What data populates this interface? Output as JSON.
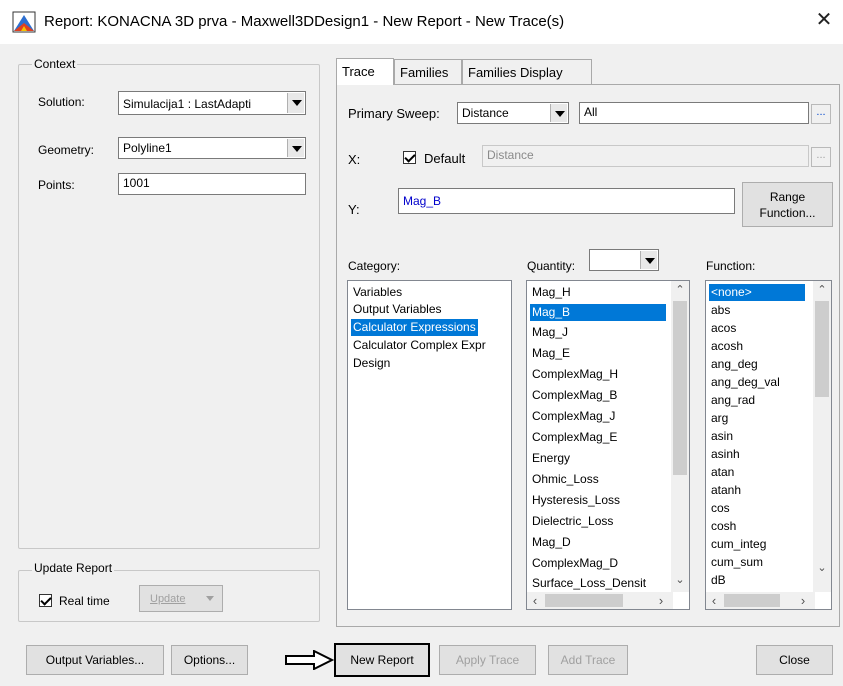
{
  "window": {
    "title": "Report: KONACNA 3D prva - Maxwell3DDesign1 - New Report - New Trace(s)",
    "close_glyph": "✕",
    "icon": "report-app-icon"
  },
  "context": {
    "legend": "Context",
    "solution_label": "Solution:",
    "solution_value": "Simulacija1 : LastAdapti",
    "geometry_label": "Geometry:",
    "geometry_value": "Polyline1",
    "points_label": "Points:",
    "points_value": "1001"
  },
  "update_report": {
    "legend": "Update Report",
    "realtime_label": "Real time",
    "realtime_checked": true,
    "update_button": "Update"
  },
  "tabs": [
    {
      "label": "Trace",
      "active": true
    },
    {
      "label": "Families",
      "active": false
    },
    {
      "label": "Families Display",
      "active": false
    }
  ],
  "trace": {
    "primary_sweep_label": "Primary Sweep:",
    "primary_sweep_value": "Distance",
    "primary_sweep_range": "All",
    "ellipsis": "...",
    "x_label": "X:",
    "x_default_label": "Default",
    "x_default_checked": true,
    "x_value": "Distance",
    "y_label": "Y:",
    "y_value": "Mag_B",
    "range_function_line1": "Range",
    "range_function_line2": "Function..."
  },
  "category": {
    "label": "Category:",
    "items": [
      "Variables",
      "Output Variables",
      "Calculator Expressions",
      "Calculator Complex Expr",
      "Design"
    ],
    "selected": "Calculator Expressions"
  },
  "quantity": {
    "label": "Quantity:",
    "filter_value": "",
    "items": [
      "Mag_H",
      "Mag_B",
      "Mag_J",
      "Mag_E",
      "ComplexMag_H",
      "ComplexMag_B",
      "ComplexMag_J",
      "ComplexMag_E",
      "Energy",
      "Ohmic_Loss",
      "Hysteresis_Loss",
      "Dielectric_Loss",
      "Mag_D",
      "ComplexMag_D",
      "Surface_Loss_Densit"
    ],
    "selected": "Mag_B"
  },
  "function": {
    "label": "Function:",
    "items": [
      "<none>",
      "abs",
      "acos",
      "acosh",
      "ang_deg",
      "ang_deg_val",
      "ang_rad",
      "arg",
      "asin",
      "asinh",
      "atan",
      "atanh",
      "cos",
      "cosh",
      "cum_integ",
      "cum_sum",
      "dB"
    ],
    "selected": "<none>"
  },
  "footer": {
    "output_variables": "Output Variables...",
    "options": "Options...",
    "new_report": "New Report",
    "apply_trace": "Apply Trace",
    "add_trace": "Add Trace",
    "close": "Close"
  },
  "colors": {
    "selection": "#0078d7",
    "y_text": "#0000cc",
    "dialog_bg": "#f0f0f0"
  }
}
